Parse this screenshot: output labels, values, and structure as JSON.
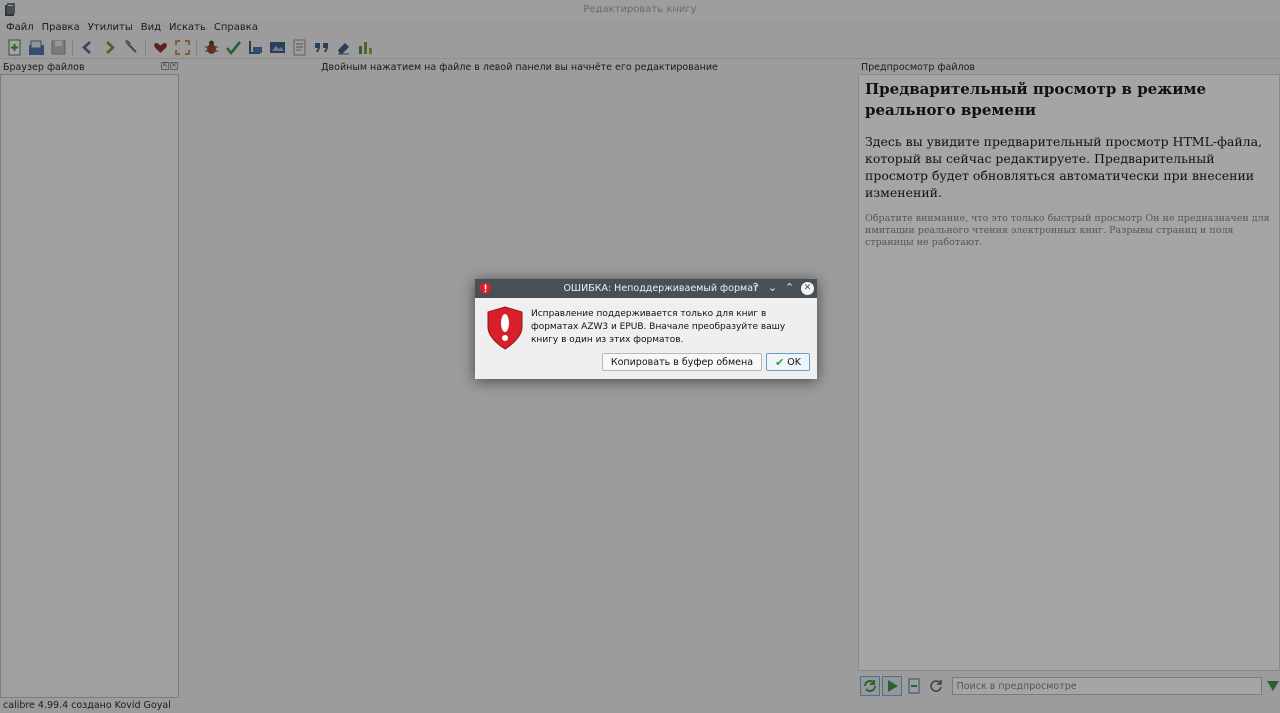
{
  "window": {
    "title": "Редактировать книгу"
  },
  "menu": {
    "items": [
      {
        "label": "Файл"
      },
      {
        "label": "Правка"
      },
      {
        "label": "Утилиты"
      },
      {
        "label": "Вид"
      },
      {
        "label": "Искать"
      },
      {
        "label": "Справка"
      }
    ]
  },
  "toolbar": {
    "icons": [
      "new-file-icon",
      "open-book-icon",
      "save-icon",
      "back-icon",
      "forward-icon",
      "hammer-icon",
      "heart-icon",
      "fullscreen-icon",
      "bug-icon",
      "spellcheck-icon",
      "toc-icon",
      "pic-icon",
      "report-icon",
      "quote-icon",
      "eraser-icon",
      "chart-icon"
    ]
  },
  "file_browser": {
    "title": "Браузер файлов"
  },
  "editor": {
    "hint": "Двойным нажатием на файле в левой панели вы начнёте его редактирование"
  },
  "preview": {
    "title": "Предпросмотр файлов",
    "heading": "Предварительный просмотр в режиме реального времени",
    "paragraph": "Здесь вы увидите предварительный просмотр HTML-файла, который вы сейчас редактируете. Предварительный просмотр будет обновляться автоматически при внесении изменений.",
    "note": "Обратите внимание, что это только быстрый просмотр Он не предназначен для имитации реального чтения электронных книг. Разрывы страниц и поля страницы не работают.",
    "search_placeholder": "Поиск в предпросмотре"
  },
  "status": {
    "text": "calibre 4.99.4 создано Kovid Goyal"
  },
  "dialog": {
    "title": "ОШИБКА: Неподдерживаемый формат",
    "message": "Исправление поддерживается только для книг в форматах AZW3 и EPUB. Вначале преобразуйте вашу книгу в один из этих форматов.",
    "copy_button": "Копировать в буфер обмена",
    "ok_button": "OK",
    "help_glyph": "?",
    "colors": {
      "titlebar": "#475057",
      "error_red": "#d6202a",
      "ok_green": "#3a9a2a"
    }
  }
}
